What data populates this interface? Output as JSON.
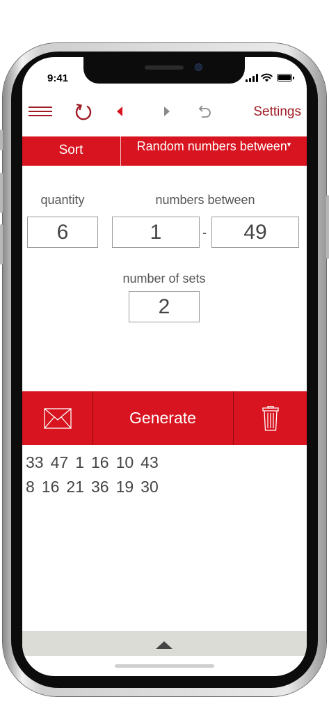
{
  "status": {
    "time": "9:41"
  },
  "toolbar": {
    "menu_icon": "hamburger-icon",
    "refresh_icon": "refresh-icon",
    "back_icon": "triangle-left-icon",
    "forward_icon": "triangle-right-icon",
    "undo_icon": "undo-icon",
    "settings_label": "Settings"
  },
  "header": {
    "sort_label": "Sort",
    "mode_label": "Random numbers between",
    "mode_caret": "▾"
  },
  "inputs": {
    "quantity_label": "quantity",
    "quantity_value": "6",
    "range_label": "numbers between",
    "range_min": "1",
    "range_separator": "-",
    "range_max": "49",
    "sets_label": "number of sets",
    "sets_value": "2"
  },
  "actions": {
    "mail_icon": "envelope-icon",
    "generate_label": "Generate",
    "trash_icon": "trash-icon"
  },
  "results": [
    [
      "33",
      "47",
      "1",
      "16",
      "10",
      "43"
    ],
    [
      "8",
      "16",
      "21",
      "36",
      "19",
      "30"
    ]
  ],
  "colors": {
    "accent": "#d7141f",
    "accent_dark": "#9f1b24",
    "bottom_bar": "#dcdcd6"
  }
}
